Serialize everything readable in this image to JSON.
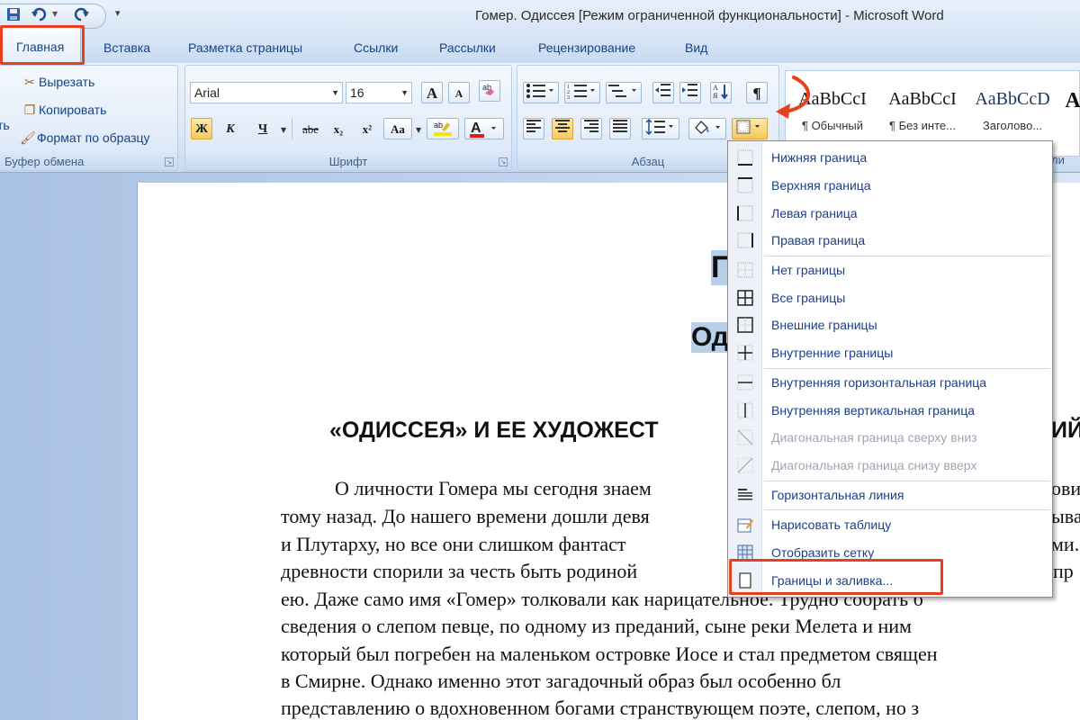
{
  "window": {
    "title": "Гомер. Одиссея [Режим ограниченной функциональности] - Microsoft Word"
  },
  "quick_access": {
    "save_icon": "save-icon",
    "undo_icon": "undo-icon",
    "redo_icon": "redo-icon",
    "customize": "▾"
  },
  "tabs": {
    "home": "Главная",
    "insert": "Вставка",
    "page_layout": "Разметка страницы",
    "references": "Ссылки",
    "mailings": "Рассылки",
    "review": "Рецензирование",
    "view": "Вид"
  },
  "clipboard": {
    "paste_fragment": "ть",
    "cut": "Вырезать",
    "copy": "Копировать",
    "format_painter": "Формат по образцу",
    "label": "Буфер обмена"
  },
  "font": {
    "name": "Arial",
    "size": "16",
    "grow": "A",
    "shrink": "A",
    "bold": "Ж",
    "italic": "К",
    "underline": "Ч",
    "strike": "abe",
    "subscript": "x₂",
    "superscript": "x²",
    "case": "Aa",
    "label": "Шрифт"
  },
  "paragraph": {
    "show_marks": "¶",
    "label": "Абзац"
  },
  "styles": {
    "items": [
      {
        "preview": "AaBbCcI",
        "name": "¶ Обычный"
      },
      {
        "preview": "AaBbCcI",
        "name": "¶ Без инте..."
      },
      {
        "preview": "AaBbCcD",
        "name": "Заголово..."
      },
      {
        "preview": "A",
        "name": ""
      }
    ],
    "label_fragment": "ли"
  },
  "document": {
    "line_g": "Г",
    "line_od": "Од",
    "heading": "«ОДИССЕЯ» И ЕЕ ХУДОЖЕСТ",
    "heading_tail": "ИЙ",
    "lines": [
      "О личности Гомера мы сегодня знаем",
      "тому назад. До нашего времени дошли девя",
      "и Плутарху, но все они слишком фантаст",
      "древности спорили за честь быть родиной",
      "ею. Даже само имя «Гомер» толковали как нарицательное. Трудно собрать б",
      "сведения о слепом певце, по одному из преданий, сыне реки Мелета и ним",
      "который был погребен на маленьком островке Иосе и стал предметом священ",
      "в   Смирне.   Однако   именно   этот   загадочный   образ   был   особенно   бл",
      "представлению о вдохновенном богами странствующем поэте, слепом, но з"
    ],
    "right_fragments": [
      "ови",
      "ыва",
      "ми.",
      "пр"
    ]
  },
  "borders_menu": {
    "items": [
      {
        "label": "Нижняя граница",
        "icon": "bottom-border-icon",
        "enabled": true
      },
      {
        "label": "Верхняя граница",
        "icon": "top-border-icon",
        "enabled": true
      },
      {
        "label": "Левая граница",
        "icon": "left-border-icon",
        "enabled": true
      },
      {
        "label": "Правая граница",
        "icon": "right-border-icon",
        "enabled": true
      },
      {
        "label": "Нет границы",
        "icon": "no-border-icon",
        "enabled": true
      },
      {
        "label": "Все границы",
        "icon": "all-borders-icon",
        "enabled": true
      },
      {
        "label": "Внешние границы",
        "icon": "outside-borders-icon",
        "enabled": true
      },
      {
        "label": "Внутренние границы",
        "icon": "inside-borders-icon",
        "enabled": true
      },
      {
        "label": "Внутренняя горизонтальная граница",
        "icon": "inside-horizontal-border-icon",
        "enabled": true
      },
      {
        "label": "Внутренняя вертикальная граница",
        "icon": "inside-vertical-border-icon",
        "enabled": true
      },
      {
        "label": "Диагональная граница сверху вниз",
        "icon": "diagonal-down-border-icon",
        "enabled": false
      },
      {
        "label": "Диагональная граница снизу вверх",
        "icon": "diagonal-up-border-icon",
        "enabled": false
      },
      {
        "label": "Горизонтальная линия",
        "icon": "horizontal-line-icon",
        "enabled": true
      },
      {
        "label": "Нарисовать таблицу",
        "icon": "draw-table-icon",
        "enabled": true
      },
      {
        "label": "Отобразить сетку",
        "icon": "view-gridlines-icon",
        "enabled": true
      },
      {
        "label": "Границы и заливка...",
        "icon": "borders-and-shading-icon",
        "enabled": true
      }
    ]
  },
  "colors": {
    "highlight_box": "#e8401f",
    "arrow": "#e8401f",
    "ribbon_text": "#15428b",
    "menu_text": "#1b3f8b",
    "disabled_text": "#9ea6b3"
  }
}
